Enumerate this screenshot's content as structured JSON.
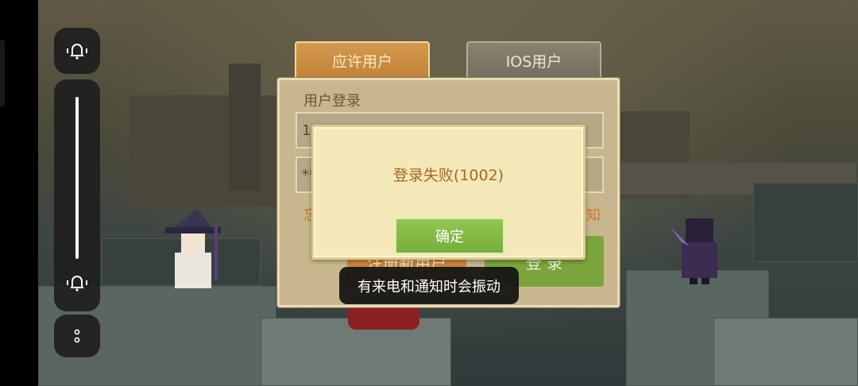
{
  "system_panel": {
    "ring_top_icon": "bell-vibrate-icon",
    "ring_bottom_icon": "bell-vibrate-icon",
    "more_icon": "more-dots-icon",
    "volume_level": 1.0
  },
  "tabs": [
    {
      "label": "应许用户",
      "active": true
    },
    {
      "label": "IOS用户",
      "active": false
    }
  ],
  "login": {
    "title": "用户登录",
    "account_value": "17",
    "password_value": "**",
    "forgot_label": "忘",
    "notice_label": "知",
    "register_label": "注册新用户",
    "login_label": "登 录"
  },
  "dialog": {
    "message": "登录失败(1002)",
    "ok_label": "确定"
  },
  "toast": {
    "text": "有来电和通知时会振动"
  },
  "colors": {
    "dialog_bg": "#f4e8b8",
    "ok_button": "#85b946",
    "active_tab": "#c98c42",
    "message_text": "#a3672a"
  }
}
